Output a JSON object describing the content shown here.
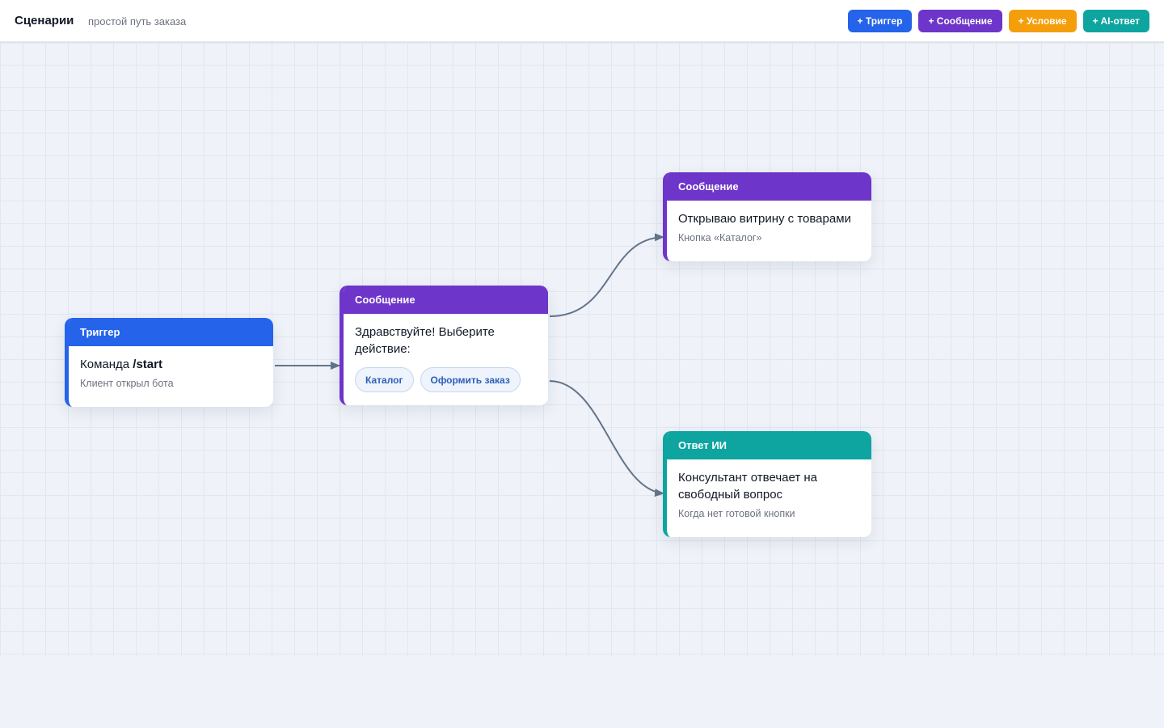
{
  "header": {
    "title": "Сценарии",
    "subtitle": "простой путь заказа"
  },
  "toolbar": {
    "buttons": [
      {
        "label": "+ Триггер",
        "color": "#2563eb"
      },
      {
        "label": "+ Сообщение",
        "color": "#6d35c9"
      },
      {
        "label": "+ Условие",
        "color": "#f59e0b"
      },
      {
        "label": "+ AI-ответ",
        "color": "#0ea5a0"
      }
    ]
  },
  "nodes": {
    "trigger": {
      "header": "Триггер",
      "main_prefix": "Команда ",
      "main_bold": "/start",
      "sub": "Клиент открыл бота",
      "color": "#2563eb"
    },
    "message_welcome": {
      "header": "Сообщение",
      "main": "Здравствуйте! Выберите действие:",
      "buttons": [
        "Каталог",
        "Оформить заказ"
      ],
      "color": "#6d35c9"
    },
    "message_catalog": {
      "header": "Сообщение",
      "main": "Открываю витрину с товарами",
      "sub": "Кнопка «Каталог»",
      "color": "#6d35c9"
    },
    "ai_answer": {
      "header": "Ответ ИИ",
      "main": "Консультант отвечает на свободный вопрос",
      "sub": "Когда нет готовой кнопки",
      "color": "#0ea5a0"
    }
  },
  "edge_color": "#64748b"
}
